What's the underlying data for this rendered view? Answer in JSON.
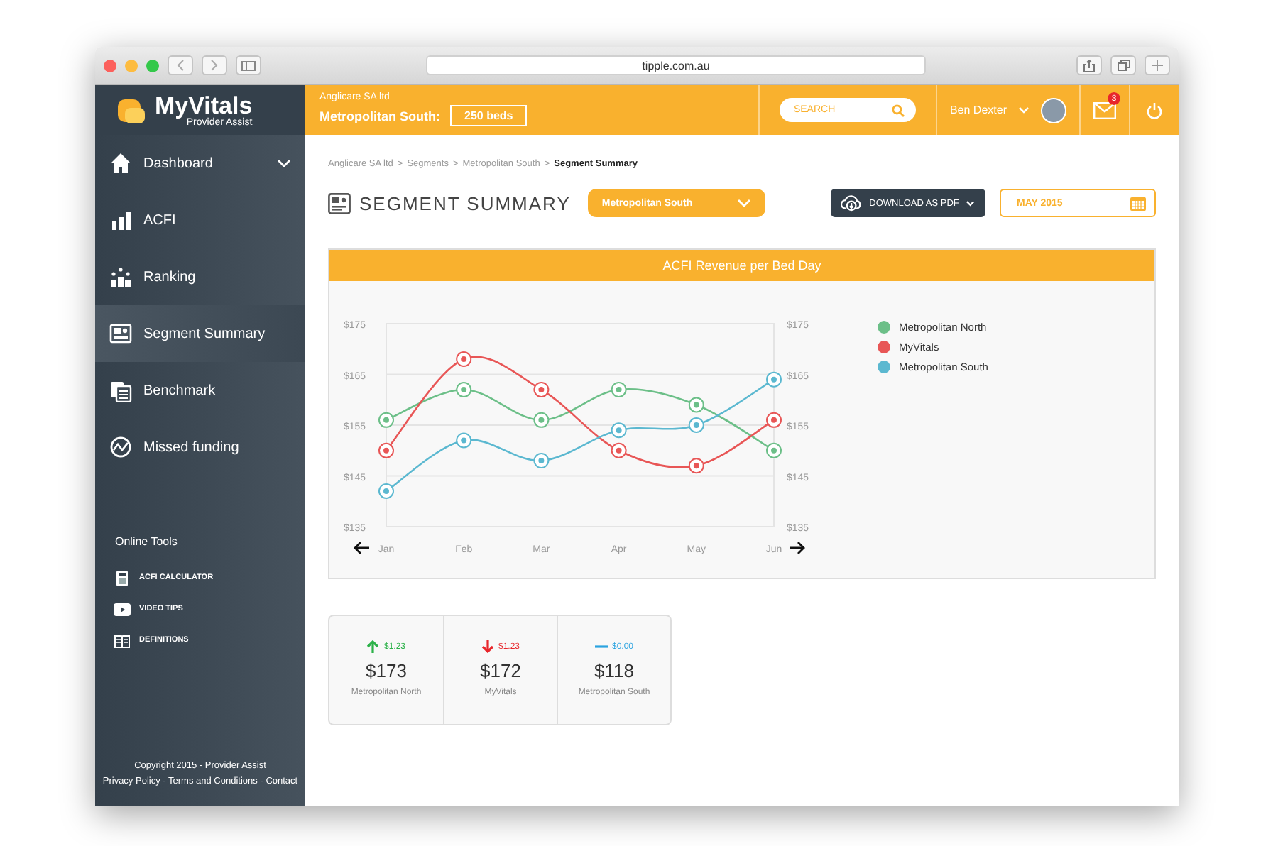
{
  "browser": {
    "url": "tipple.com.au"
  },
  "brand": {
    "name": "MyVitals",
    "tagline": "Provider Assist"
  },
  "header": {
    "organisation": "Anglicare SA ltd",
    "segment": "Metropolitan South:",
    "beds": "250 beds",
    "search_placeholder": "SEARCH",
    "user": "Ben Dexter",
    "unread": "3"
  },
  "sidebar": {
    "items": [
      {
        "label": "Dashboard",
        "selected": false
      },
      {
        "label": "ACFI",
        "selected": false
      },
      {
        "label": "Ranking",
        "selected": false
      },
      {
        "label": "Segment Summary",
        "selected": true
      },
      {
        "label": "Benchmark",
        "selected": false
      },
      {
        "label": "Missed funding",
        "selected": false
      }
    ],
    "tools_title": "Online Tools",
    "tools": [
      "ACFI CALCULATOR",
      "VIDEO TIPS",
      "DEFINITIONS"
    ],
    "copyright": "Copyright 2015 - Provider Assist",
    "links": [
      "Privacy Policy",
      "Terms and Conditions",
      "Contact"
    ],
    "link_separator": "-"
  },
  "breadcrumb": [
    "Anglicare SA ltd",
    "Segments",
    "Metropolitan South",
    "Segment Summary"
  ],
  "breadcrumb_separator": ">",
  "page_title": "SEGMENT SUMMARY",
  "segment_select": "Metropolitan South",
  "download_button": "DOWNLOAD AS PDF",
  "month_field": "MAY 2015",
  "chart_card": {
    "title": "ACFI Revenue per Bed Day",
    "chart_data": {
      "type": "line",
      "grid": true,
      "categories": [
        "Jan",
        "Feb",
        "Mar",
        "Apr",
        "May",
        "Jun"
      ],
      "ylim": [
        135,
        175
      ],
      "yticks": [
        {
          "value": 175,
          "label": "$175"
        },
        {
          "value": 165,
          "label": "$165"
        },
        {
          "value": 155,
          "label": "$155"
        },
        {
          "value": 145,
          "label": "$145"
        },
        {
          "value": 135,
          "label": "$135"
        }
      ],
      "series": [
        {
          "name": "Metropolitan North",
          "color": "#6cbf88",
          "marker": "circle",
          "values": [
            156,
            162,
            156,
            162,
            159,
            150
          ]
        },
        {
          "name": "MyVitals",
          "color": "#e85656",
          "marker": "circle",
          "values": [
            150,
            168,
            162,
            150,
            147,
            156
          ]
        },
        {
          "name": "Metropolitan South",
          "color": "#5bb8d0",
          "marker": "circle",
          "values": [
            142,
            152,
            148,
            154,
            155,
            164
          ]
        }
      ]
    }
  },
  "stats": [
    {
      "kind": "up",
      "change": "$1.23",
      "value": "$173",
      "label": "Metropolitan North",
      "color": "#2db24a"
    },
    {
      "kind": "down",
      "change": "$1.23",
      "value": "$172",
      "label": "MyVitals",
      "color": "#e8262b"
    },
    {
      "kind": "flat",
      "change": "$0.00",
      "value": "$118",
      "label": "Metropolitan South",
      "color": "#2ba3e0"
    }
  ]
}
